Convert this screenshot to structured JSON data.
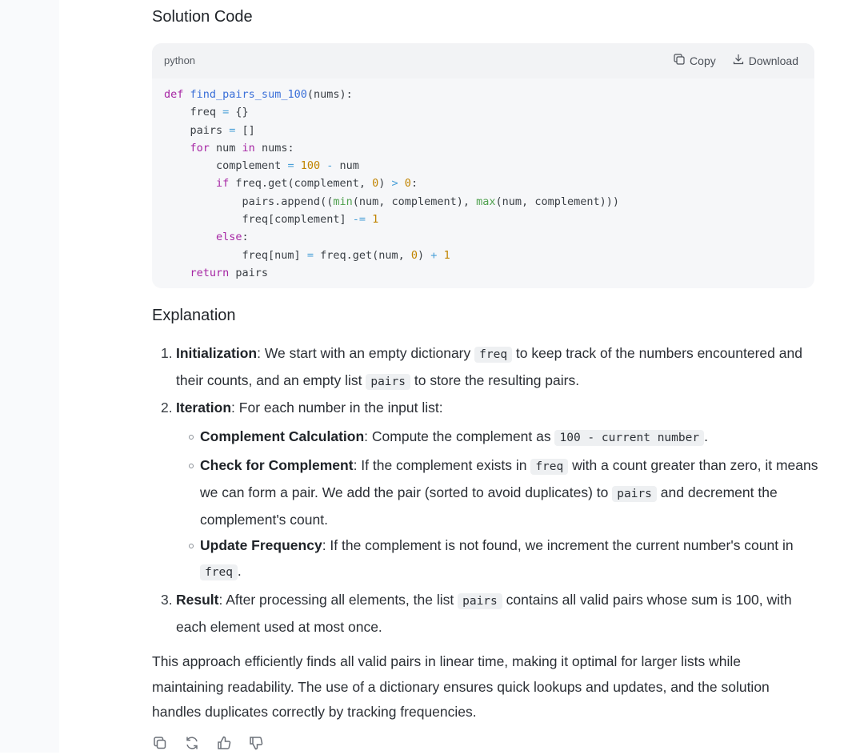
{
  "solution_title": "Solution Code",
  "code_block": {
    "language": "python",
    "copy_label": "Copy",
    "download_label": "Download"
  },
  "explanation_title": "Explanation",
  "list": {
    "n1": "1.",
    "n2": "2.",
    "n3": "3.",
    "item1_title": "Initialization",
    "item1_a": ": We start with an empty dictionary ",
    "item1_code": "freq",
    "item1_b": " to keep track of the numbers encountered and",
    "item1_c": "their counts, and an empty list ",
    "item1_code2": "pairs",
    "item1_d": " to store the resulting pairs.",
    "item2_title": "Iteration",
    "item2_a": ": For each number in the input list:",
    "sub1_title": "Complement Calculation",
    "sub1_a": ": Compute the complement as ",
    "sub1_code": "100 - current number",
    "sub1_b": ".",
    "sub2_title": "Check for Complement",
    "sub2_a": ": If the complement exists in ",
    "sub2_code": "freq",
    "sub2_b": " with a count greater than zero, it means",
    "sub2_c": "we can form a pair. We add the pair (sorted to avoid duplicates) to ",
    "sub2_code2": "pairs",
    "sub2_d": " and decrement the",
    "sub2_e": "complement's count.",
    "sub3_title": "Update Frequency",
    "sub3_a": ": If the complement is not found, we increment the current number's count in",
    "sub3_code": "freq",
    "sub3_b": ".",
    "item3_title": "Result",
    "item3_a": ": After processing all elements, the list ",
    "item3_code": "pairs",
    "item3_b": " contains all valid pairs whose sum is 100, with",
    "item3_c": "each element used at most once."
  },
  "summary": {
    "l1": "This approach efficiently finds all valid pairs in linear time, making it optimal for larger lists while",
    "l2": "maintaining readability. The use of a dictionary ensures quick lookups and updates, and the solution",
    "l3": "handles duplicates correctly by tracking frequencies."
  },
  "icons": [
    "copy-icon",
    "download-icon",
    "regenerate-icon",
    "thumbs-up-icon",
    "thumbs-down-icon"
  ]
}
